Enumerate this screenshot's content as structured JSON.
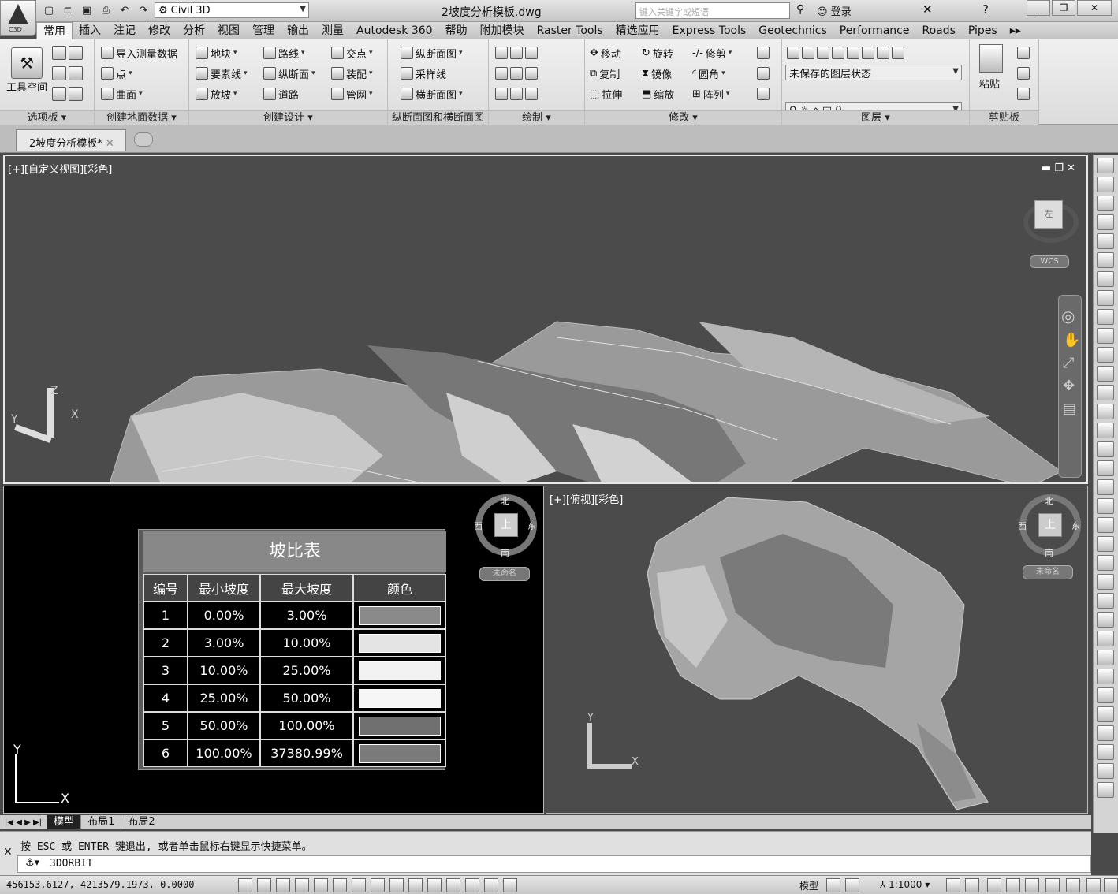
{
  "app": {
    "logo_label": "C3D",
    "workspace": "Civil 3D",
    "doc_title": "2坡度分析模板.dwg",
    "search_placeholder": "键入关键字或短语",
    "login": "登录"
  },
  "menu": [
    "常用",
    "插入",
    "注记",
    "修改",
    "分析",
    "视图",
    "管理",
    "输出",
    "测量",
    "Autodesk 360",
    "帮助",
    "附加模块",
    "Raster Tools",
    "精选应用",
    "Express Tools",
    "Geotechnics",
    "Performance",
    "Roads",
    "Pipes"
  ],
  "ribbon": {
    "toolspace": "工具空间",
    "panel_feet": {
      "palettes": "选项板",
      "ground": "创建地面数据",
      "design": "创建设计",
      "profile": "纵断面图和横断面图",
      "draw": "绘制",
      "modify": "修改",
      "layers": "图层",
      "clipboard": "剪贴板"
    },
    "ground": {
      "import": "导入测量数据",
      "points": "点",
      "surface": "曲面"
    },
    "design": {
      "parcel": "地块",
      "featureline": "要素线",
      "grading": "放坡",
      "alignment": "路线",
      "profile": "纵断面",
      "corridor": "道路",
      "intersection": "交点",
      "assembly": "装配",
      "pipenetwork": "管网"
    },
    "profileview": {
      "profileview": "纵断面图",
      "sampleline": "采样线",
      "sectionview": "横断面图"
    },
    "modify": {
      "move": "移动",
      "rotate": "旋转",
      "trim": "修剪",
      "copy": "复制",
      "mirror": "镜像",
      "fillet": "圆角",
      "stretch": "拉伸",
      "scale": "缩放",
      "array": "阵列"
    },
    "layers": {
      "state": "未保存的图层状态",
      "current": "0"
    },
    "clipboard": {
      "paste": "粘贴"
    }
  },
  "doctab": "2坡度分析模板*",
  "viewport1": {
    "label": "[+][自定义视图][彩色]",
    "wcs": "WCS",
    "cube_face": "左"
  },
  "viewport2": {
    "compass": {
      "n": "北",
      "s": "南",
      "e": "东",
      "w": "西",
      "face": "上"
    },
    "unnamed": "未命名"
  },
  "viewport3": {
    "label": "[+][俯视][彩色]",
    "compass": {
      "n": "北",
      "s": "南",
      "e": "东",
      "w": "西",
      "face": "上"
    },
    "unnamed": "未命名"
  },
  "slope_table": {
    "title": "坡比表",
    "headers": [
      "编号",
      "最小坡度",
      "最大坡度",
      "颜色"
    ],
    "rows": [
      {
        "id": "1",
        "min": "0.00%",
        "max": "3.00%",
        "color": "#8a8a8a"
      },
      {
        "id": "2",
        "min": "3.00%",
        "max": "10.00%",
        "color": "#e4e4e4"
      },
      {
        "id": "3",
        "min": "10.00%",
        "max": "25.00%",
        "color": "#f2f2f2"
      },
      {
        "id": "4",
        "min": "25.00%",
        "max": "50.00%",
        "color": "#f6f6f6"
      },
      {
        "id": "5",
        "min": "50.00%",
        "max": "100.00%",
        "color": "#707070"
      },
      {
        "id": "6",
        "min": "100.00%",
        "max": "37380.99%",
        "color": "#7a7a7a"
      }
    ]
  },
  "axis": {
    "x": "X",
    "y": "Y",
    "z": "Z"
  },
  "layout_tabs": [
    "模型",
    "布局1",
    "布局2"
  ],
  "command": {
    "history": "按 ESC 或 ENTER 键退出, 或者单击鼠标右键显示快捷菜单。",
    "current": "3DORBIT"
  },
  "status": {
    "coords": "456153.6127, 4213579.1973, 0.0000",
    "model": "模型",
    "scale": "1:1000"
  }
}
